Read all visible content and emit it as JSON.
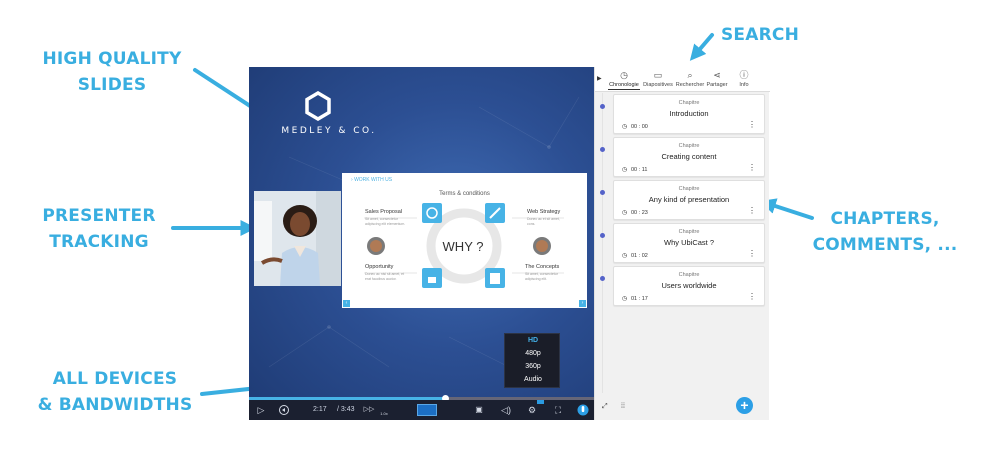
{
  "callouts": {
    "slides_line1": "HIGH QUALITY",
    "slides_line2": "SLIDES",
    "search": "SEARCH",
    "presenter_line1": "PRESENTER",
    "presenter_line2": "TRACKING",
    "chapters_line1": "CHAPTERS,",
    "chapters_line2": "COMMENTS, ...",
    "devices_line1": "ALL DEVICES",
    "devices_line2": "& BANDWIDTHS"
  },
  "colors": {
    "callout": "#39aee0",
    "accent": "#2c9fe6",
    "timeline_dot": "#5563c9",
    "player_bg": "#2c4f93",
    "controls_bg": "#1b2030"
  },
  "player": {
    "brand_name": "MEDLEY & CO.",
    "slide": {
      "breadcrumb": "WORK WITH US",
      "title": "Terms & conditions",
      "center_text": "WHY ?",
      "labels": [
        {
          "title": "Sales Proposal",
          "sub": "Sit amet, consectetur adipiscing elit elementum."
        },
        {
          "title": "Web Strategy",
          "sub": "Donec ac et sit amet, cons."
        },
        {
          "title": "Opportunity",
          "sub": "Donec ac nisi sit amet, et erat faucibus auctor."
        },
        {
          "title": "The Concepts",
          "sub": "Sit amet, consectetur adipiscing elit."
        }
      ]
    },
    "quality_menu": {
      "options": [
        "HD",
        "480p",
        "360p",
        "Audio"
      ],
      "selected": "HD"
    },
    "progress": 0.57,
    "time_current": "2:17",
    "time_total": "/ 3:43",
    "speed_label": "1.0x",
    "icons": [
      "play-icon",
      "rewind-icon",
      "forward-icon",
      "comments-icon",
      "volume-icon",
      "settings-icon",
      "fullscreen-icon",
      "microphone-icon"
    ]
  },
  "sidebar": {
    "tabs": [
      {
        "label": "Chronologie",
        "icon": "clock-icon",
        "active": true
      },
      {
        "label": "Diapositives",
        "icon": "slides-icon",
        "active": false
      },
      {
        "label": "Rechercher",
        "icon": "search-icon",
        "active": false
      },
      {
        "label": "Partager",
        "icon": "share-icon",
        "active": false
      },
      {
        "label": "Info",
        "icon": "info-icon",
        "active": false
      }
    ],
    "chapters": [
      {
        "type": "Chapitre",
        "title": "Introduction",
        "time": "00 : 00"
      },
      {
        "type": "Chapitre",
        "title": "Creating content",
        "time": "00 : 11"
      },
      {
        "type": "Chapitre",
        "title": "Any kind of presentation",
        "time": "00 : 23"
      },
      {
        "type": "Chapitre",
        "title": "Why UbiCast ?",
        "time": "01 : 02"
      },
      {
        "type": "Chapitre",
        "title": "Users worldwide",
        "time": "01 : 17"
      }
    ]
  }
}
